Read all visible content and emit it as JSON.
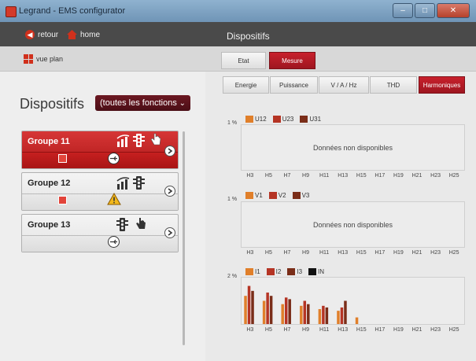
{
  "window": {
    "title": "Legrand - EMS configurator",
    "controls": [
      "–",
      "□",
      "✕"
    ]
  },
  "nav": {
    "back_label": "retour",
    "home_label": "home",
    "plan_label": "vue plan"
  },
  "right_header": {
    "title": "Dispositifs"
  },
  "view_tabs": [
    {
      "label": "Etat",
      "selected": false
    },
    {
      "label": "Mesure",
      "selected": true
    }
  ],
  "measure_tabs": [
    {
      "label": "Energie",
      "selected": false
    },
    {
      "label": "Puissance",
      "selected": false
    },
    {
      "label": "V / A / Hz",
      "selected": false
    },
    {
      "label": "THD",
      "selected": false
    },
    {
      "label": "Harmoniques",
      "selected": true
    }
  ],
  "device_list": {
    "heading": "Dispositifs",
    "filter_value": "(toutes les fonctions",
    "groups": [
      {
        "name": "Groupe 11",
        "selected": true,
        "icons": [
          "meter-icon",
          "traffic-light-icon",
          "hand-icon"
        ],
        "status": [
          "alert-square-icon",
          "usb-icon"
        ]
      },
      {
        "name": "Groupe 12",
        "selected": false,
        "icons": [
          "meter-icon",
          "traffic-light-icon"
        ],
        "status": [
          "alert-square-icon",
          "warning-triangle-icon"
        ]
      },
      {
        "name": "Groupe 13",
        "selected": false,
        "icons": [
          "traffic-light-icon",
          "hand-icon"
        ],
        "status": [
          "usb-icon"
        ]
      }
    ]
  },
  "chart_data": [
    {
      "type": "bar",
      "ytick": "1 %",
      "categories": [
        "H3",
        "H5",
        "H7",
        "H9",
        "H11",
        "H13",
        "H15",
        "H17",
        "H19",
        "H21",
        "H23",
        "H25"
      ],
      "series": [
        {
          "name": "U12",
          "color": "#e07f2a",
          "values": []
        },
        {
          "name": "U23",
          "color": "#b53424",
          "values": []
        },
        {
          "name": "U31",
          "color": "#7a2d18",
          "values": []
        }
      ],
      "message": "Données non disponibles"
    },
    {
      "type": "bar",
      "ytick": "1 %",
      "categories": [
        "H3",
        "H5",
        "H7",
        "H9",
        "H11",
        "H13",
        "H15",
        "H17",
        "H19",
        "H21",
        "H23",
        "H25"
      ],
      "series": [
        {
          "name": "V1",
          "color": "#e07f2a",
          "values": []
        },
        {
          "name": "V2",
          "color": "#b53424",
          "values": []
        },
        {
          "name": "V3",
          "color": "#7a2d18",
          "values": []
        }
      ],
      "message": "Données non disponibles"
    },
    {
      "type": "bar",
      "ytick": "2 %",
      "ymax": 2.8,
      "categories": [
        "H3",
        "H5",
        "H7",
        "H9",
        "H11",
        "H13",
        "H15",
        "H17",
        "H19",
        "H21",
        "H23",
        "H25"
      ],
      "series": [
        {
          "name": "I1",
          "color": "#e07f2a",
          "values": [
            1.7,
            1.4,
            1.2,
            1.1,
            0.9,
            0.8,
            0.4,
            0,
            0,
            0,
            0,
            0
          ]
        },
        {
          "name": "I2",
          "color": "#b53424",
          "values": [
            2.3,
            1.9,
            1.6,
            1.4,
            1.1,
            1.0,
            0,
            0,
            0,
            0,
            0,
            0
          ]
        },
        {
          "name": "I3",
          "color": "#7a2d18",
          "values": [
            2.0,
            1.7,
            1.5,
            1.2,
            1.0,
            1.4,
            0,
            0,
            0,
            0,
            0,
            0
          ]
        },
        {
          "name": "IN",
          "color": "#111111",
          "values": [
            0,
            0,
            0,
            0,
            0,
            0,
            0,
            0,
            0,
            0,
            0,
            0
          ]
        }
      ]
    }
  ]
}
